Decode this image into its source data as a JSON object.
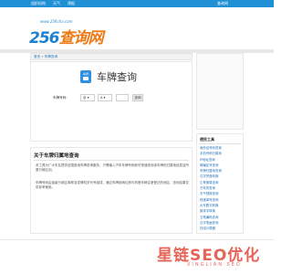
{
  "topbar": {
    "links": [
      "组织机构",
      "天气",
      "预报"
    ],
    "right_text": "查询网"
  },
  "logo": {
    "url_text": "www.256cha.com",
    "number": "256",
    "name": "查询网"
  },
  "breadcrumb": {
    "text": "首页 » 车牌查询"
  },
  "tool": {
    "icon_text": "车牌",
    "title": "车牌查询",
    "label": "车牌号码:",
    "province": "京",
    "letter": "A",
    "button": "查询"
  },
  "article": {
    "title": "关于车牌归属地查询",
    "paragraphs": [
      "本工具为广大车友提供全国各地车牌查询服务，只需输入汽车车牌号码即可快速查询该车牌的归属地信息及所属行政区划。",
      "车牌号码由省级行政区简称及发牌机关代号组成，通过车牌前两位即可判断车辆注册登记的地区，查询结果仅供参考使用。"
    ]
  },
  "sidebar": {
    "heading": "便民工具",
    "items": [
      "身份证号码查询",
      "手机号码归属地",
      "IP地址查询",
      "邮编区号查询",
      "车牌归属地查询",
      "汉字拼音转换",
      "汇率换算查询",
      "万年历查询",
      "天气预报查询",
      "快递单号查询",
      "大写数字转换",
      "繁体字转换",
      "五笔编码查询",
      "汉字笔画查询",
      "在线计算器"
    ]
  },
  "watermark": {
    "cn": "星链SEO优化",
    "en": "XINGLIAN SEO"
  },
  "colors": {
    "accent": "#1f8fd6",
    "logo_orange": "#ee7a15",
    "watermark_red": "#e04a3a"
  }
}
